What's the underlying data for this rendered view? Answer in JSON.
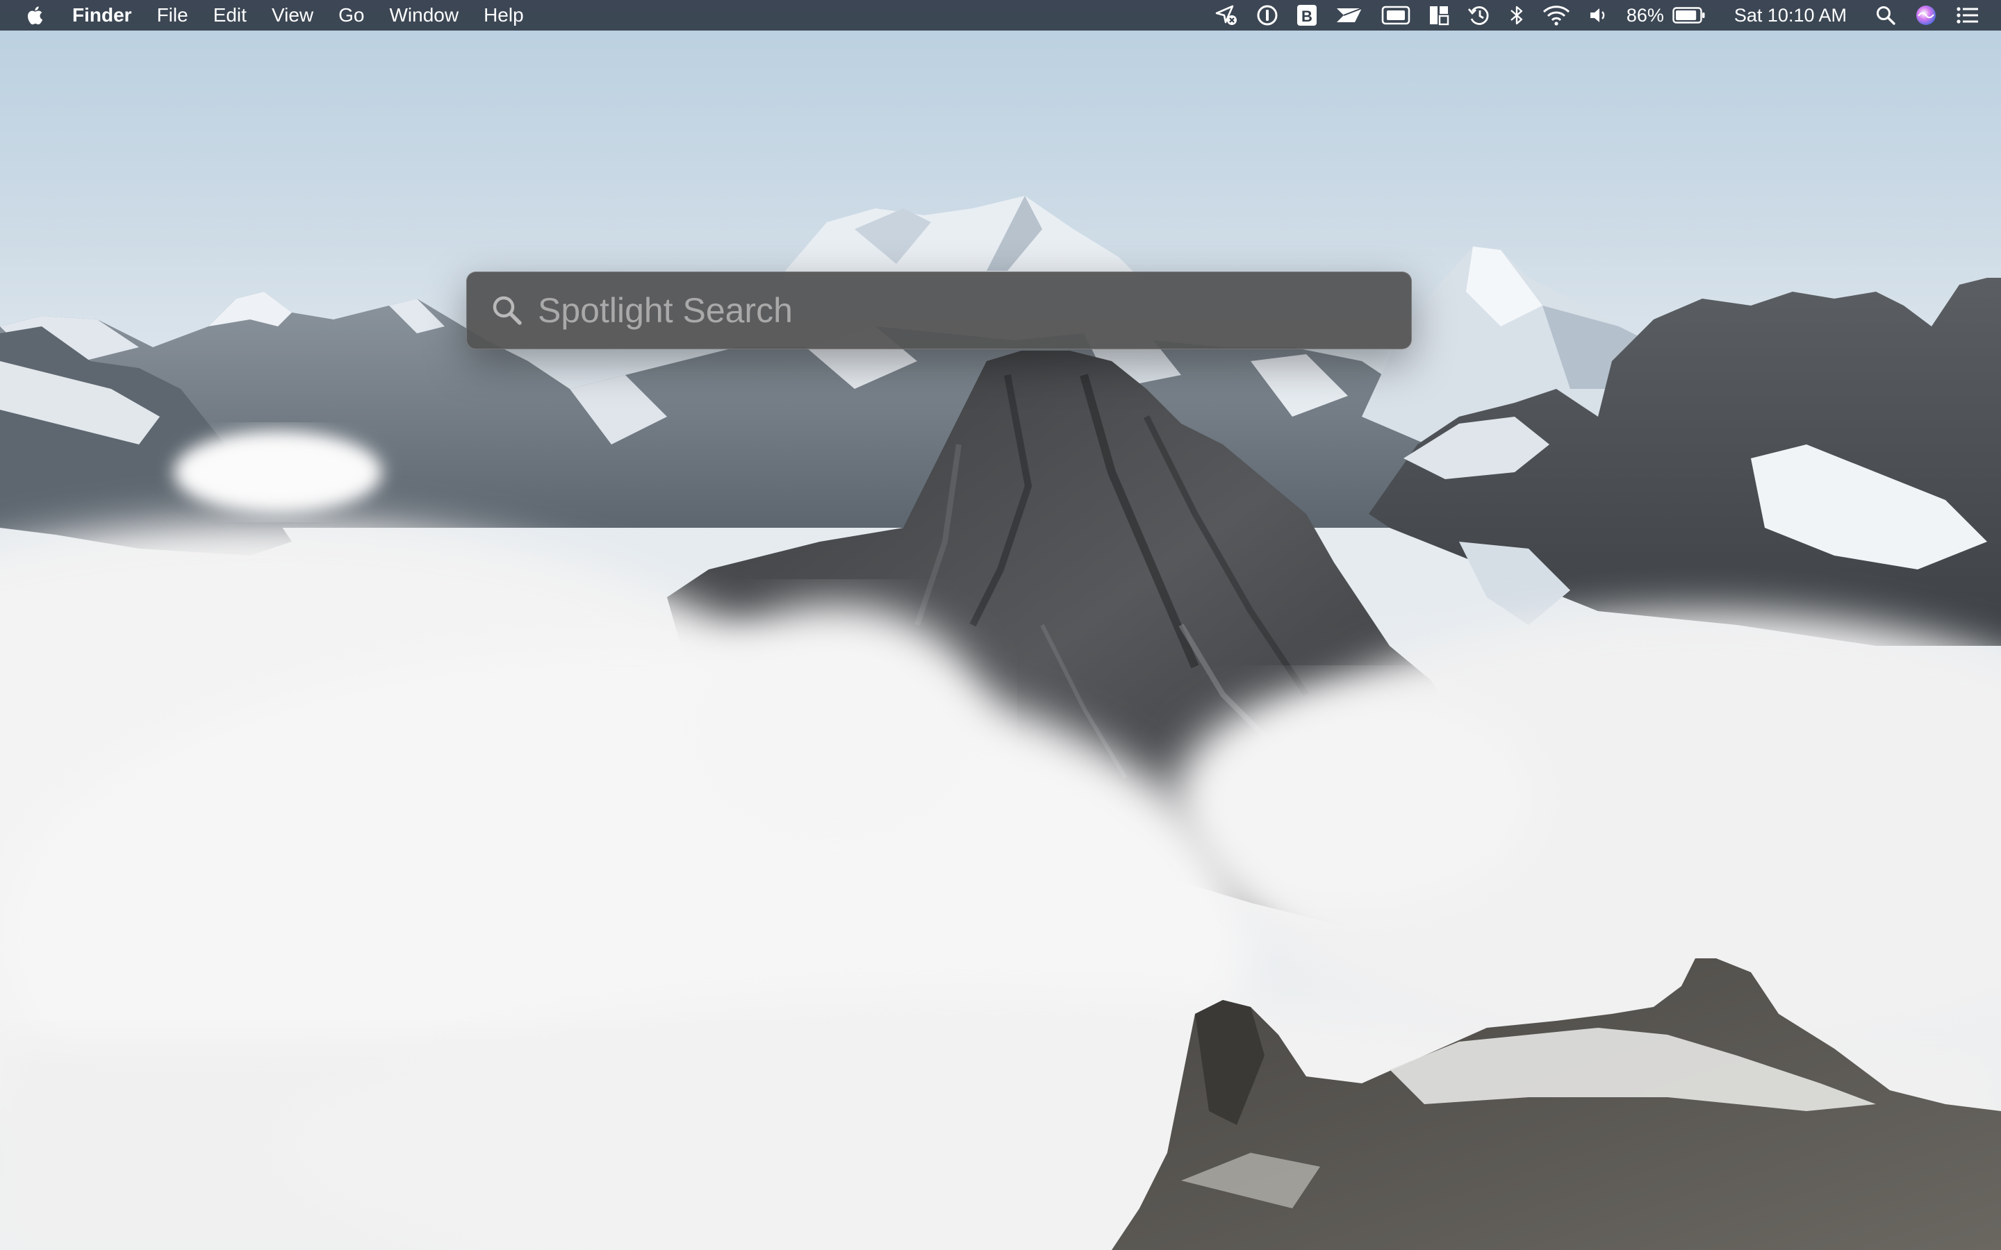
{
  "menubar": {
    "apple_icon": "apple-logo-icon",
    "app_name": "Finder",
    "menus": [
      "File",
      "Edit",
      "View",
      "Go",
      "Window",
      "Help"
    ],
    "status_icons": [
      "location-disabled-icon",
      "1password-icon",
      "bartender-icon",
      "airmail-icon",
      "display-icon",
      "magnet-icon",
      "time-machine-icon",
      "bluetooth-icon",
      "wifi-icon",
      "volume-icon"
    ],
    "battery_percent": "86%",
    "battery_level": 0.86,
    "clock": "Sat 10:10 AM",
    "spotlight_icon": "search-icon",
    "siri_icon": "siri-icon",
    "notification_icon": "notification-center-icon"
  },
  "spotlight": {
    "placeholder": "Spotlight Search",
    "value": "",
    "icon": "search-icon"
  },
  "desktop": {
    "wallpaper": "snowy-mountain-peaks-above-clouds"
  },
  "colors": {
    "menubar_bg": "#343e4a",
    "spotlight_bg": "#525252",
    "placeholder_text": "#a9a9a9"
  }
}
